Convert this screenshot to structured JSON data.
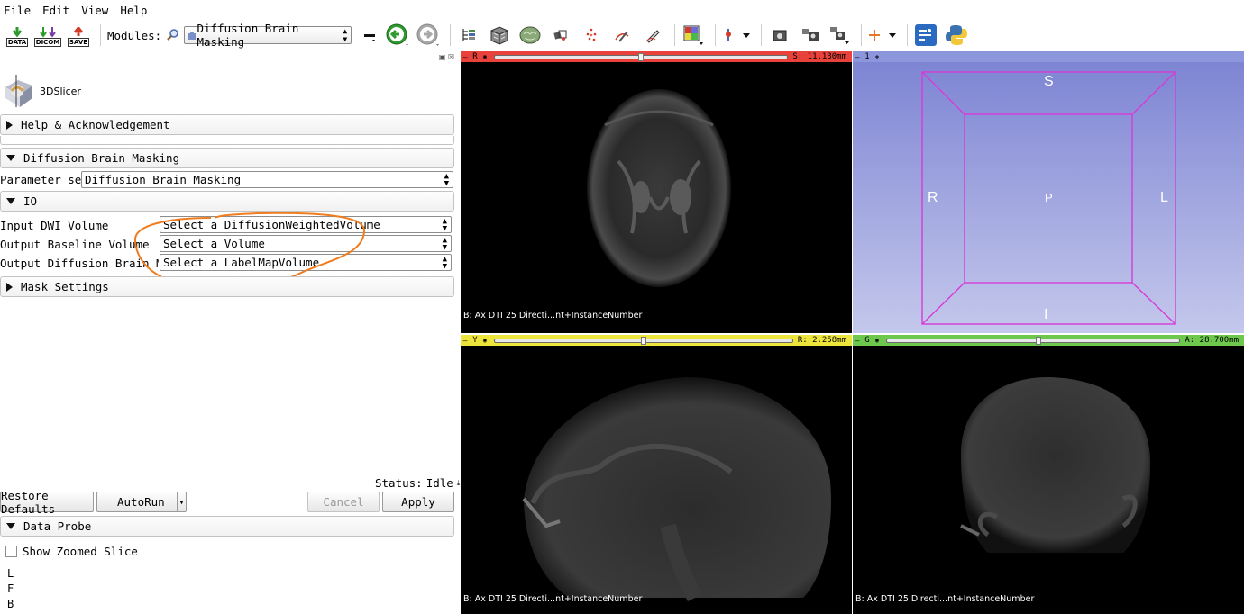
{
  "menu": [
    "File",
    "Edit",
    "View",
    "Help"
  ],
  "toolbar": {
    "data_label": "DATA",
    "dicom_label": "DICOM",
    "save_label": "SAVE",
    "modules_label": "Modules:",
    "module_selected": "Diffusion Brain Masking"
  },
  "logo": {
    "text": "3DSlicer"
  },
  "panel": {
    "help_section": "Help & Acknowledgement",
    "module_section": "Diffusion Brain Masking",
    "parameter_set_label": "Parameter set:",
    "parameter_set_value": "Diffusion Brain Masking",
    "io_section": "IO",
    "io_rows": [
      {
        "label": "Input DWI Volume",
        "value": "Select a DiffusionWeightedVolume"
      },
      {
        "label": "Output Baseline Volume",
        "value": "Select a Volume"
      },
      {
        "label": "Output Diffusion Brain Mask",
        "value": "Select a LabelMapVolume"
      }
    ],
    "mask_section": "Mask Settings",
    "status_label": "Status:",
    "status_value": "Idle",
    "buttons": {
      "restore": "Restore Defaults",
      "autorun": "AutoRun",
      "cancel": "Cancel",
      "apply": "Apply"
    },
    "probe_section": "Data Probe",
    "show_zoomed": "Show Zoomed Slice",
    "probe_lines": [
      "L",
      "F",
      "B"
    ]
  },
  "viewers": {
    "red": {
      "name": "R",
      "value": "S: 11.130mm",
      "slider": 0.5,
      "footer": "B: Ax DTI 25 Directi...nt+InstanceNumber",
      "color": "#e8423a"
    },
    "threed": {
      "name": "1",
      "labels": {
        "S": "S",
        "I": "I",
        "R": "R",
        "L": "L",
        "P": "P"
      },
      "color": "#8c96dc"
    },
    "yellow": {
      "name": "Y",
      "value": "R: 2.258mm",
      "slider": 0.5,
      "footer": "B: Ax DTI 25 Directi...nt+InstanceNumber",
      "color": "#ede43c"
    },
    "green": {
      "name": "G",
      "value": "A: 28.700mm",
      "slider": 0.52,
      "footer": "B: Ax DTI 25 Directi...nt+InstanceNumber",
      "color": "#6ec84e"
    }
  },
  "colors": {
    "annotation": "#f07c1e",
    "threed_bg_top": "#7b82d2",
    "threed_bg_bottom": "#c4c8ec",
    "box": "#d83ad8"
  }
}
